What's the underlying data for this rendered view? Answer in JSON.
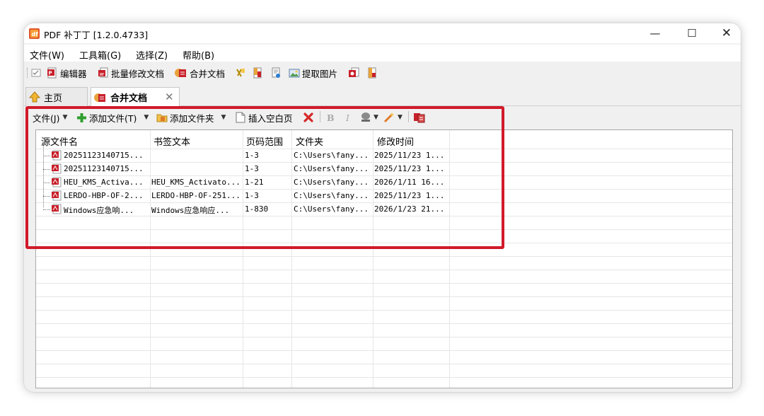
{
  "window": {
    "title": "PDF 补丁丁 [1.2.0.4733]",
    "minimize": "—",
    "maximize": "☐",
    "close": "✕"
  },
  "menu": [
    "文件(W)",
    "工具箱(G)",
    "选择(Z)",
    "帮助(B)"
  ],
  "toolbar": {
    "editor": "编辑器",
    "batch_modify": "批量修改文档",
    "merge": "合并文档",
    "extract_images": "提取图片"
  },
  "tabs": {
    "home": "主页",
    "merge": "合并文档",
    "close": "✕"
  },
  "merge_toolbar": {
    "file_menu": "文件(J)",
    "add_file": "添加文件(T)",
    "add_folder": "添加文件夹",
    "insert_blank": "插入空白页",
    "bold": "B",
    "italic": "I"
  },
  "columns": [
    "源文件名",
    "书签文本",
    "页码范围",
    "文件夹",
    "修改时间"
  ],
  "rows": [
    {
      "name": "20251123140715...",
      "bookmark": "",
      "pages": "1-3",
      "folder": "C:\\Users\\fany...",
      "modified": "2025/11/23 1..."
    },
    {
      "name": "20251123140715...",
      "bookmark": "",
      "pages": "1-3",
      "folder": "C:\\Users\\fany...",
      "modified": "2025/11/23 1..."
    },
    {
      "name": "HEU_KMS_Activa...",
      "bookmark": "HEU_KMS_Activato...",
      "pages": "1-21",
      "folder": "C:\\Users\\fany...",
      "modified": "2026/1/11 16..."
    },
    {
      "name": "LERDO-HBP-OF-2...",
      "bookmark": "LERDO-HBP-OF-251...",
      "pages": "1-3",
      "folder": "C:\\Users\\fany...",
      "modified": "2025/11/23 1..."
    },
    {
      "name": "Windows应急响...",
      "bookmark": "Windows应急响应...",
      "pages": "1-830",
      "folder": "C:\\Users\\fany...",
      "modified": "2026/1/23 21..."
    }
  ],
  "colors": {
    "highlight": "#d11a2a",
    "pdf_red": "#c8202a",
    "add_green": "#2e9e2e"
  }
}
